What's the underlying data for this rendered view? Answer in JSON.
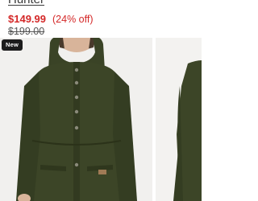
{
  "product": {
    "brand": "Hunter",
    "price": "$149.99",
    "discount": "(24% off)",
    "original_price": "$199.00",
    "badge": "New"
  },
  "colors": {
    "sale_red": "#d42828",
    "jacket_olive": "#3c4527",
    "badge_bg": "#1c1c1c"
  }
}
